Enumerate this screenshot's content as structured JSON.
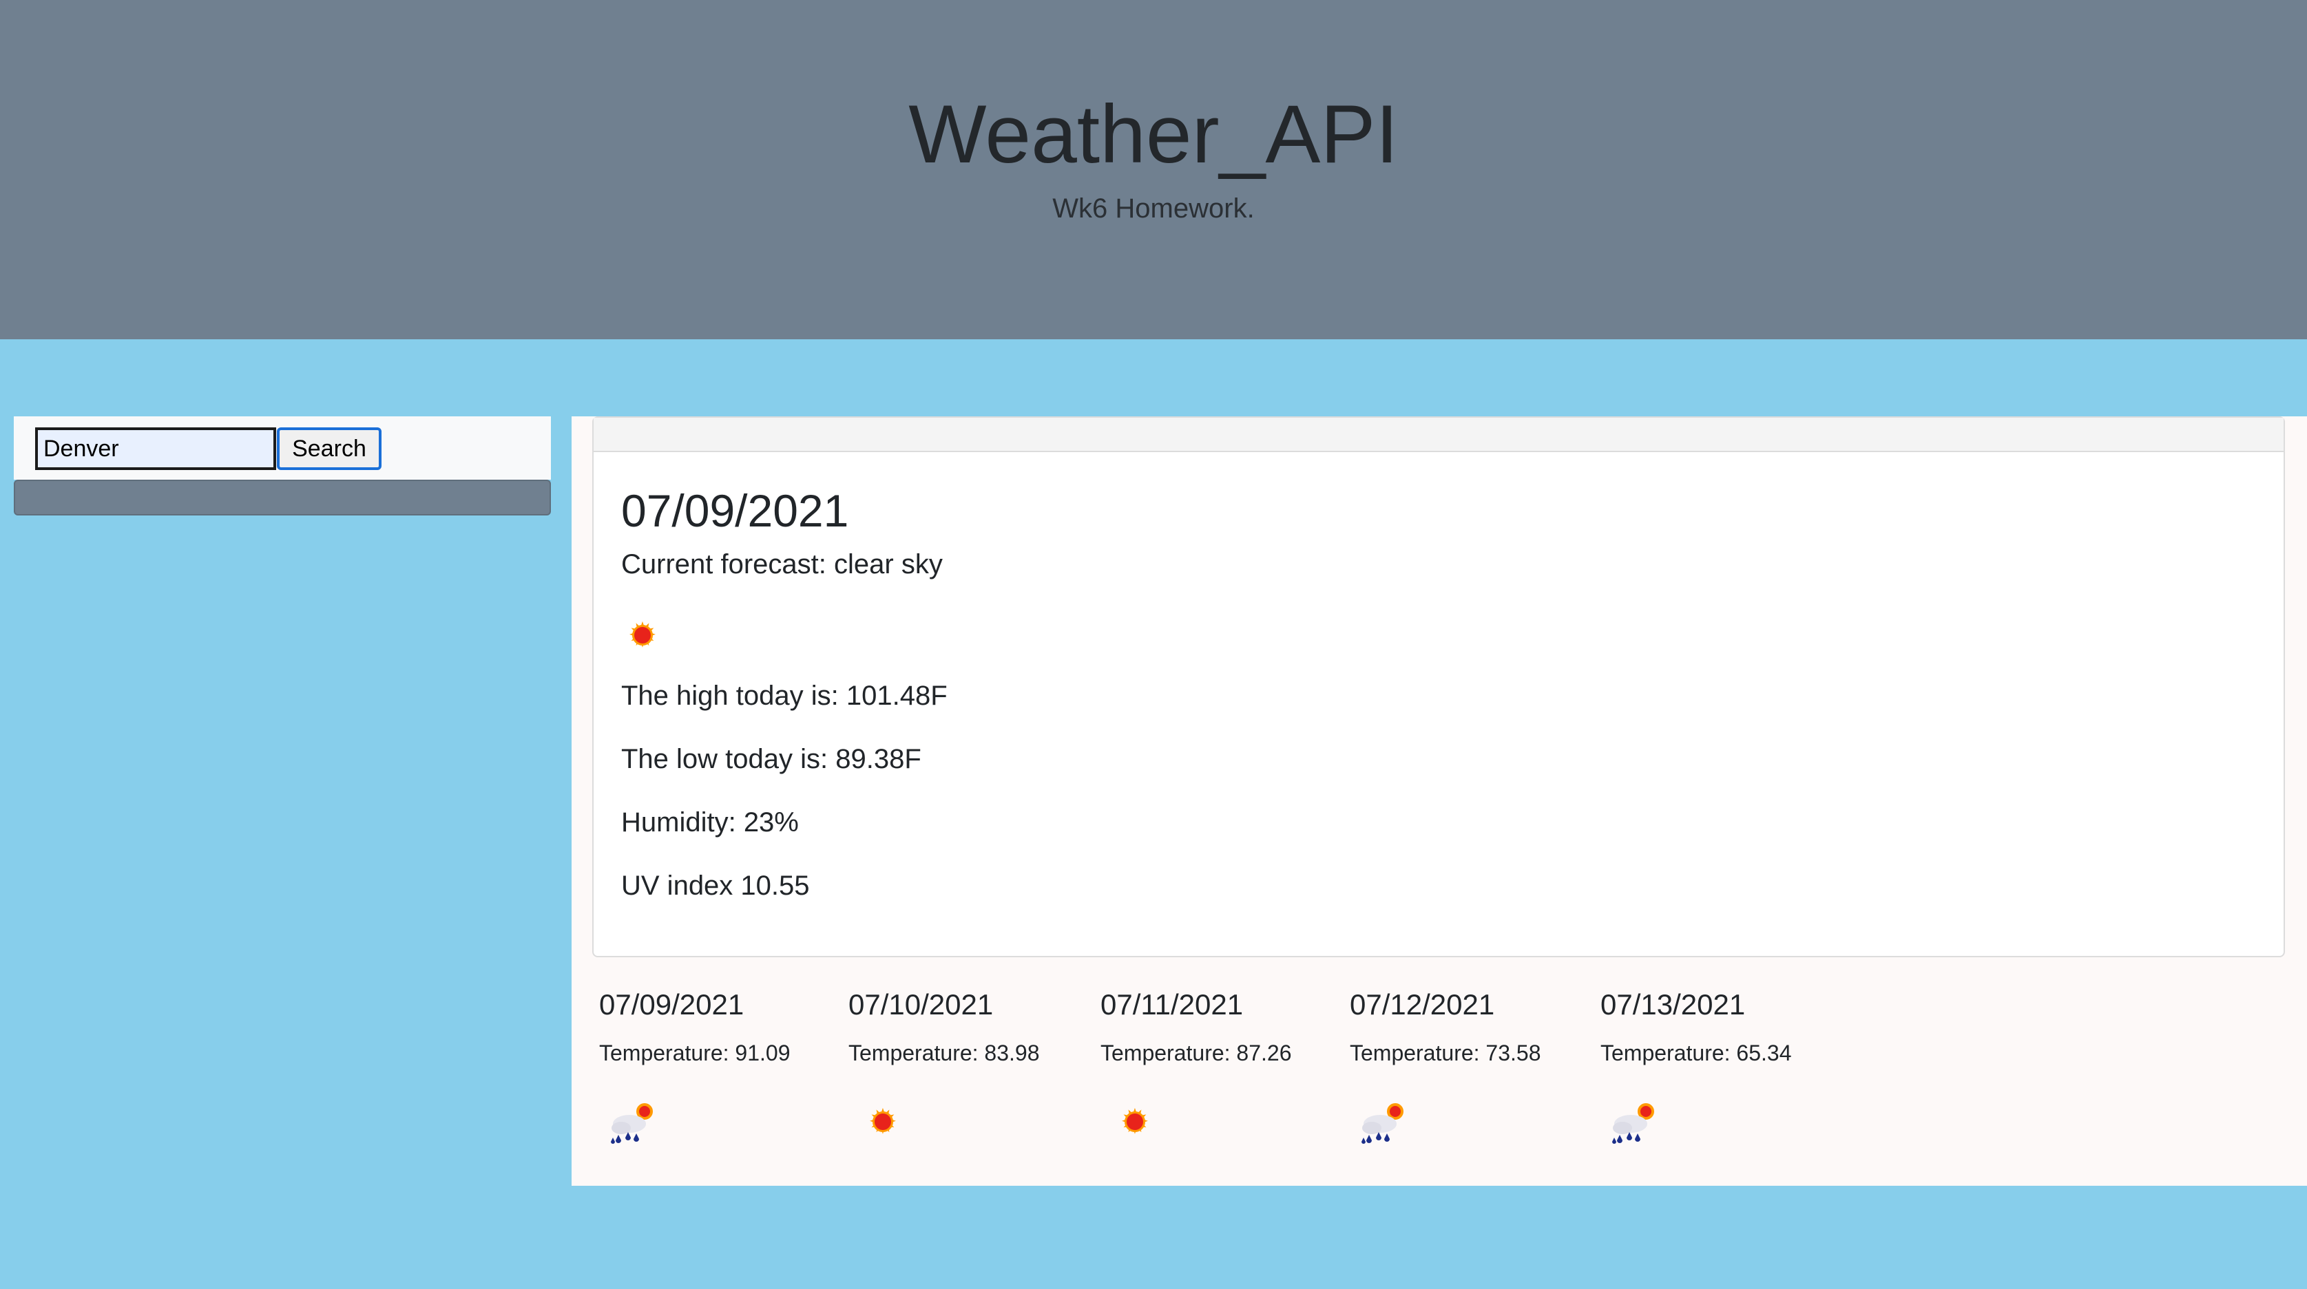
{
  "header": {
    "title": "Weather_API",
    "subtitle": "Wk6 Homework."
  },
  "search": {
    "value": "Denver",
    "button_label": "Search"
  },
  "current": {
    "date": "07/09/2021",
    "forecast": "Current forecast: clear sky",
    "icon": "sun-icon",
    "high": "The high today is: 101.48F",
    "low": "The low today is: 89.38F",
    "humidity": "Humidity: 23%",
    "uv": "UV index 10.55"
  },
  "forecast": [
    {
      "date": "07/09/2021",
      "temperature": "Temperature: 91.09",
      "icon": "rain-sun-icon"
    },
    {
      "date": "07/10/2021",
      "temperature": "Temperature: 83.98",
      "icon": "sun-icon"
    },
    {
      "date": "07/11/2021",
      "temperature": "Temperature: 87.26",
      "icon": "sun-icon"
    },
    {
      "date": "07/12/2021",
      "temperature": "Temperature: 73.58",
      "icon": "rain-sun-icon"
    },
    {
      "date": "07/13/2021",
      "temperature": "Temperature: 65.34",
      "icon": "rain-sun-icon"
    }
  ],
  "colors": {
    "header_bg": "#708090",
    "page_bg": "#87ceeb"
  }
}
